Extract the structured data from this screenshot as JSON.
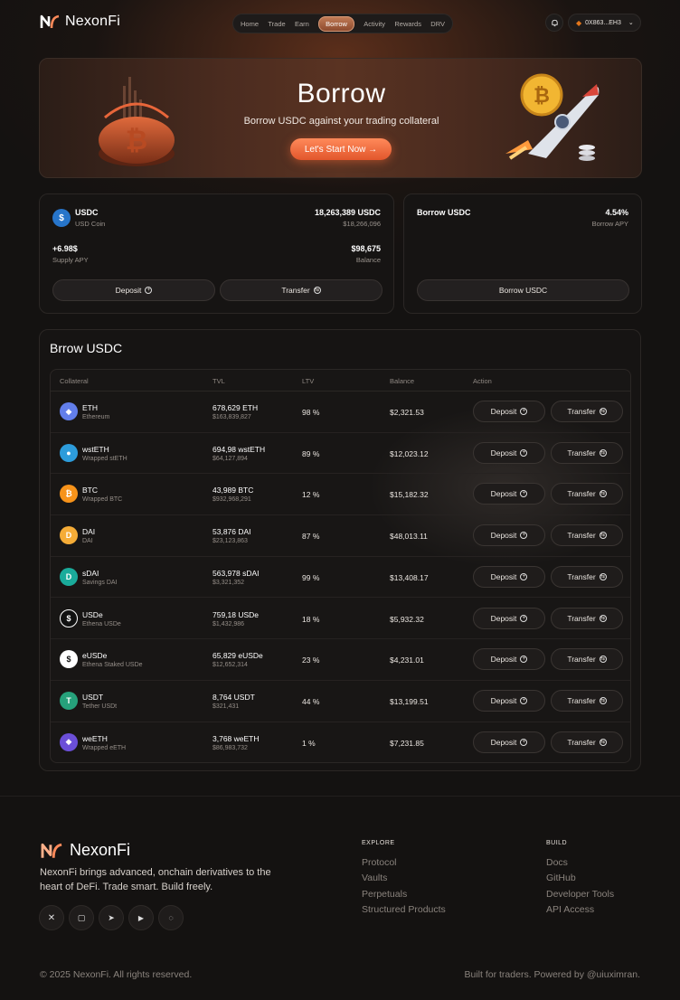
{
  "nav": {
    "brand": "NexonFi",
    "menu": [
      "Home",
      "Trade",
      "Earn",
      "Borrow",
      "Activity",
      "Rewards",
      "DRV"
    ],
    "active": "Borrow",
    "wallet": "0X863...EH3"
  },
  "hero": {
    "title": "Borrow",
    "subtitle": "Borrow USDC against your trading collateral",
    "cta": "Let's Start Now →"
  },
  "supply_card": {
    "asset": "USDC",
    "asset_sub": "USD Coin",
    "amount": "18,263,389 USDC",
    "amount_usd": "$18,266,096",
    "apy_value": "+6.98$",
    "apy_label": "Supply APY",
    "balance_value": "$98,675",
    "balance_label": "Balance",
    "deposit_label": "Deposit",
    "transfer_label": "Transfer"
  },
  "borrow_card": {
    "title": "Borrow USDC",
    "apy_value": "4.54%",
    "apy_label": "Borrow APY",
    "button_label": "Borrow USDC"
  },
  "table": {
    "title": "Brrow USDC",
    "headers": [
      "Collateral",
      "TVL",
      "LTV",
      "Balance",
      "Action"
    ],
    "deposit_label": "Deposit",
    "transfer_label": "Transfer",
    "rows": [
      {
        "name": "ETH",
        "sub": "Ethereum",
        "tvl": "678,629 ETH",
        "tvl_usd": "$163,839,827",
        "ltv": "98 %",
        "balance": "$2,321.53",
        "color": "#627eea",
        "glyph": "◆"
      },
      {
        "name": "wstETH",
        "sub": "Wrapped stETH",
        "tvl": "694,98 wstETH",
        "tvl_usd": "$64,127,894",
        "ltv": "89 %",
        "balance": "$12,023.12",
        "color": "#2d9cdb",
        "glyph": "●"
      },
      {
        "name": "BTC",
        "sub": "Wrapped BTC",
        "tvl": "43,989 BTC",
        "tvl_usd": "$932,968,291",
        "ltv": "12 %",
        "balance": "$15,182.32",
        "color": "#f7931a",
        "glyph": "₿"
      },
      {
        "name": "DAI",
        "sub": "DAI",
        "tvl": "53,876 DAI",
        "tvl_usd": "$23,123,863",
        "ltv": "87 %",
        "balance": "$48,013.11",
        "color": "#f5ac37",
        "glyph": "D"
      },
      {
        "name": "sDAI",
        "sub": "Savings DAI",
        "tvl": "563,978 sDAI",
        "tvl_usd": "$3,321,352",
        "ltv": "99 %",
        "balance": "$13,408.17",
        "color": "#1aab9b",
        "glyph": "D"
      },
      {
        "name": "USDe",
        "sub": "Ethena USDe",
        "tvl": "759,18 USDe",
        "tvl_usd": "$1,432,986",
        "ltv": "18 %",
        "balance": "$5,932.32",
        "color": "#111111",
        "glyph": "$"
      },
      {
        "name": "eUSDe",
        "sub": "Ethena Staked USDe",
        "tvl": "65,829 eUSDe",
        "tvl_usd": "$12,652,314",
        "ltv": "23 %",
        "balance": "$4,231.01",
        "color": "#ffffff",
        "glyph": "$"
      },
      {
        "name": "USDT",
        "sub": "Tether USDt",
        "tvl": "8,764 USDT",
        "tvl_usd": "$321,431",
        "ltv": "44 %",
        "balance": "$13,199.51",
        "color": "#26a17b",
        "glyph": "T"
      },
      {
        "name": "weETH",
        "sub": "Wrapped eETH",
        "tvl": "3,768 weETH",
        "tvl_usd": "$86,983,732",
        "ltv": "1 %",
        "balance": "$7,231.85",
        "color": "#6b4fd8",
        "glyph": "◆"
      }
    ]
  },
  "footer": {
    "brand": "NexonFi",
    "description": "NexonFi brings advanced, onchain derivatives to the heart of DeFi. Trade smart. Build freely.",
    "explore_title": "EXPLORE",
    "explore_links": [
      "Protocol",
      "Vaults",
      "Perpetuals",
      "Structured Products"
    ],
    "build_title": "BUILD",
    "build_links": [
      "Docs",
      "GitHub",
      "Developer Tools",
      "API Access"
    ],
    "copyright": "© 2025 NexonFi. All rights reserved.",
    "credit": "Built for traders. Powered by @uiuximran."
  },
  "colors": {
    "accent": "#f06a3c",
    "background": "#141211"
  }
}
